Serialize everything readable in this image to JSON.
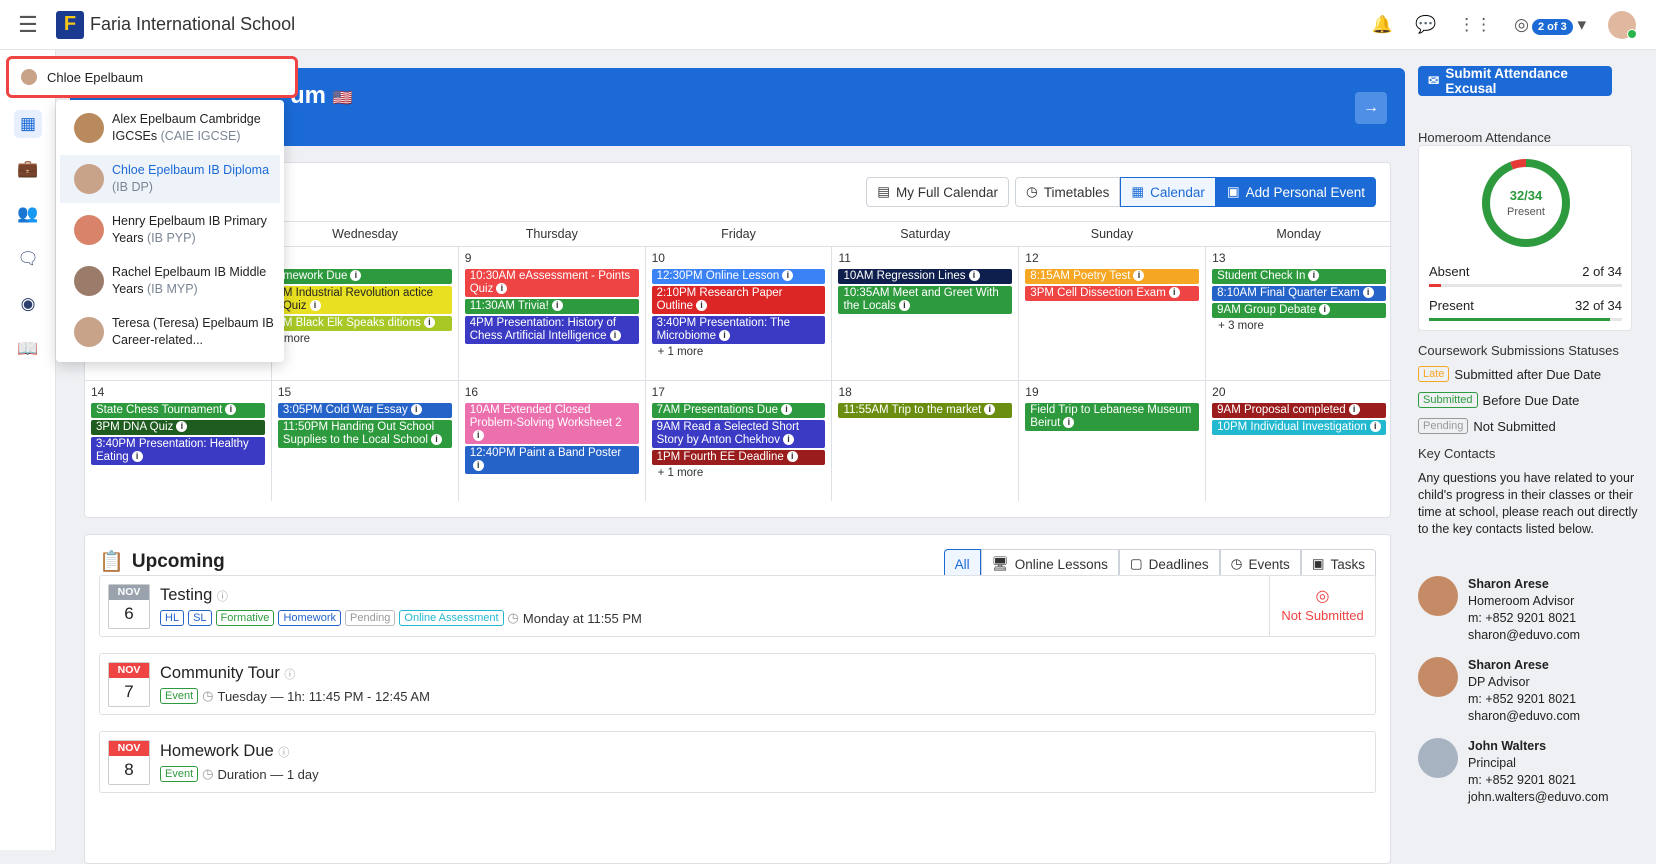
{
  "app": {
    "school": "Faria International School",
    "badge": "2 of 3"
  },
  "banner": {
    "title_fragment": "um",
    "flag": "🇺🇸"
  },
  "dropdown": {
    "selected": "Chloe Epelbaum",
    "items": [
      {
        "name": "Alex Epelbaum Cambridge IGCSEs",
        "prog": "(CAIE IGCSE)"
      },
      {
        "name": "Chloe Epelbaum IB Diploma",
        "prog": "(IB DP)"
      },
      {
        "name": "Henry Epelbaum IB Primary Years",
        "prog": "(IB PYP)"
      },
      {
        "name": "Rachel Epelbaum IB Middle Years",
        "prog": "(IB MYP)"
      },
      {
        "name": "Teresa (Teresa) Epelbaum IB Career-related...",
        "prog": ""
      }
    ]
  },
  "calendar": {
    "buttons": {
      "full": "My Full Calendar",
      "timetables": "Timetables",
      "calendar": "Calendar",
      "add": "Add Personal Event"
    },
    "days": [
      "",
      "Wednesday",
      "Thursday",
      "Friday",
      "Saturday",
      "Sunday",
      "Monday"
    ],
    "week1": [
      {
        "num": "",
        "events": [],
        "more": ""
      },
      {
        "num": "",
        "events": [
          {
            "t": "mework Due",
            "c": "#2e9a3e"
          },
          {
            "t": "M Industrial Revolution actice Quiz",
            "c": "#e8e020",
            "dark": true
          },
          {
            "t": "M Black Elk Speaks ditions",
            "c": "#a8c826"
          }
        ],
        "more": "more"
      },
      {
        "num": "9",
        "events": [
          {
            "t": "10:30AM eAssessment - Points Quiz",
            "c": "#ef4444"
          },
          {
            "t": "11:30AM Trivia!",
            "c": "#2e9a3e"
          },
          {
            "t": "4PM Presentation: History of Chess Artificial Intelligence",
            "c": "#3b3ac4"
          }
        ],
        "more": ""
      },
      {
        "num": "10",
        "events": [
          {
            "t": "12:30PM Online Lesson",
            "c": "#3b82f6"
          },
          {
            "t": "2:10PM Research Paper Outline",
            "c": "#dc2626"
          },
          {
            "t": "3:40PM Presentation: The Microbiome",
            "c": "#3b3ac4"
          }
        ],
        "more": "+ 1 more"
      },
      {
        "num": "11",
        "events": [
          {
            "t": "10AM Regression Lines",
            "c": "#0f1f4d"
          },
          {
            "t": "10:35AM Meet and Greet With the Locals",
            "c": "#2e9a3e"
          }
        ],
        "more": ""
      },
      {
        "num": "12",
        "events": [
          {
            "t": "8:15AM Poetry Test",
            "c": "#f5a623"
          },
          {
            "t": "3PM Cell Dissection Exam",
            "c": "#ef4444"
          }
        ],
        "more": ""
      },
      {
        "num": "13",
        "events": [
          {
            "t": "Student Check In",
            "c": "#2e9a3e"
          },
          {
            "t": "8:10AM Final Quarter Exam",
            "c": "#2563c9"
          },
          {
            "t": "9AM Group Debate",
            "c": "#2e9a3e"
          }
        ],
        "more": "+ 3 more"
      }
    ],
    "week2": [
      {
        "num": "14",
        "events": [
          {
            "t": "State Chess Tournament",
            "c": "#2e9a3e"
          },
          {
            "t": "3PM DNA Quiz",
            "c": "#1f5c1f"
          },
          {
            "t": "3:40PM Presentation: Healthy Eating",
            "c": "#3b3ac4"
          }
        ],
        "more": ""
      },
      {
        "num": "15",
        "events": [
          {
            "t": "3:05PM Cold War Essay",
            "c": "#2563c9"
          },
          {
            "t": "11:50PM Handing Out School Supplies to the Local School",
            "c": "#2e9a3e"
          }
        ],
        "more": ""
      },
      {
        "num": "16",
        "events": [
          {
            "t": "10AM Extended Closed Problem-Solving Worksheet 2",
            "c": "#ec6fae"
          },
          {
            "t": "12:40PM Paint a Band Poster",
            "c": "#2563c9"
          }
        ],
        "more": ""
      },
      {
        "num": "17",
        "events": [
          {
            "t": "7AM Presentations Due",
            "c": "#2e9a3e"
          },
          {
            "t": "9AM Read a Selected Short Story by Anton Chekhov",
            "c": "#3b3ac4"
          },
          {
            "t": "1PM Fourth EE Deadline",
            "c": "#9b1c1c"
          }
        ],
        "more": "+ 1 more"
      },
      {
        "num": "18",
        "events": [
          {
            "t": "11:55AM Trip to the market",
            "c": "#6b8e10"
          }
        ],
        "more": ""
      },
      {
        "num": "19",
        "events": [
          {
            "t": "Field Trip to Lebanese Museum Beirut",
            "c": "#2e9a3e"
          }
        ],
        "more": ""
      },
      {
        "num": "20",
        "events": [
          {
            "t": "9AM Proposal completed",
            "c": "#9b1c1c"
          },
          {
            "t": "10PM Individual Investigation",
            "c": "#22b8cf"
          }
        ],
        "more": ""
      }
    ]
  },
  "upcoming": {
    "title": "Upcoming",
    "filters": [
      "All",
      "Online Lessons",
      "Deadlines",
      "Events",
      "Tasks"
    ],
    "cards": [
      {
        "month": "NOV",
        "day": "6",
        "title": "Testing",
        "when": "Monday at 11:55 PM",
        "status": "Not Submitted",
        "tags": [
          "HL",
          "SL",
          "Formative",
          "Homework",
          "Pending",
          "Online Assessment"
        ]
      },
      {
        "month": "NOV",
        "day": "7",
        "title": "Community Tour",
        "when": "Tuesday — 1h: 11:45 PM - 12:45 AM",
        "tag": "Event"
      },
      {
        "month": "NOV",
        "day": "8",
        "title": "Homework Due",
        "when": "Duration — 1 day",
        "tag": "Event"
      }
    ]
  },
  "sidebar": {
    "submit": "Submit Attendance Excusal",
    "attendance_title": "Homeroom Attendance",
    "ring_value": "32/34",
    "ring_label": "Present",
    "present_fraction": 0.94,
    "absent_label": "Absent",
    "absent_value": "2 of 34",
    "present_label": "Present",
    "present_value": "32 of 34",
    "cw_title": "Coursework Submissions Statuses",
    "statuses": [
      {
        "tag": "Late",
        "text": "Submitted after Due Date",
        "color": "#f5a623"
      },
      {
        "tag": "Submitted",
        "text": "Before Due Date",
        "color": "#2e9a3e"
      },
      {
        "tag": "Pending",
        "text": "Not Submitted",
        "color": "#999999"
      }
    ],
    "key_title": "Key Contacts",
    "key_text": "Any questions you have related to your child's progress in their classes or their time at school, please reach out directly to the key contacts listed below.",
    "contacts": [
      {
        "name": "Sharon Arese",
        "role": "Homeroom Advisor",
        "phone": "m: +852 9201 8021",
        "email": "sharon@eduvo.com"
      },
      {
        "name": "Sharon Arese",
        "role": "DP Advisor",
        "phone": "m: +852 9201 8021",
        "email": "sharon@eduvo.com"
      },
      {
        "name": "John Walters",
        "role": "Principal",
        "phone": "m: +852 9201 8021",
        "email": "john.walters@eduvo.com"
      }
    ]
  }
}
